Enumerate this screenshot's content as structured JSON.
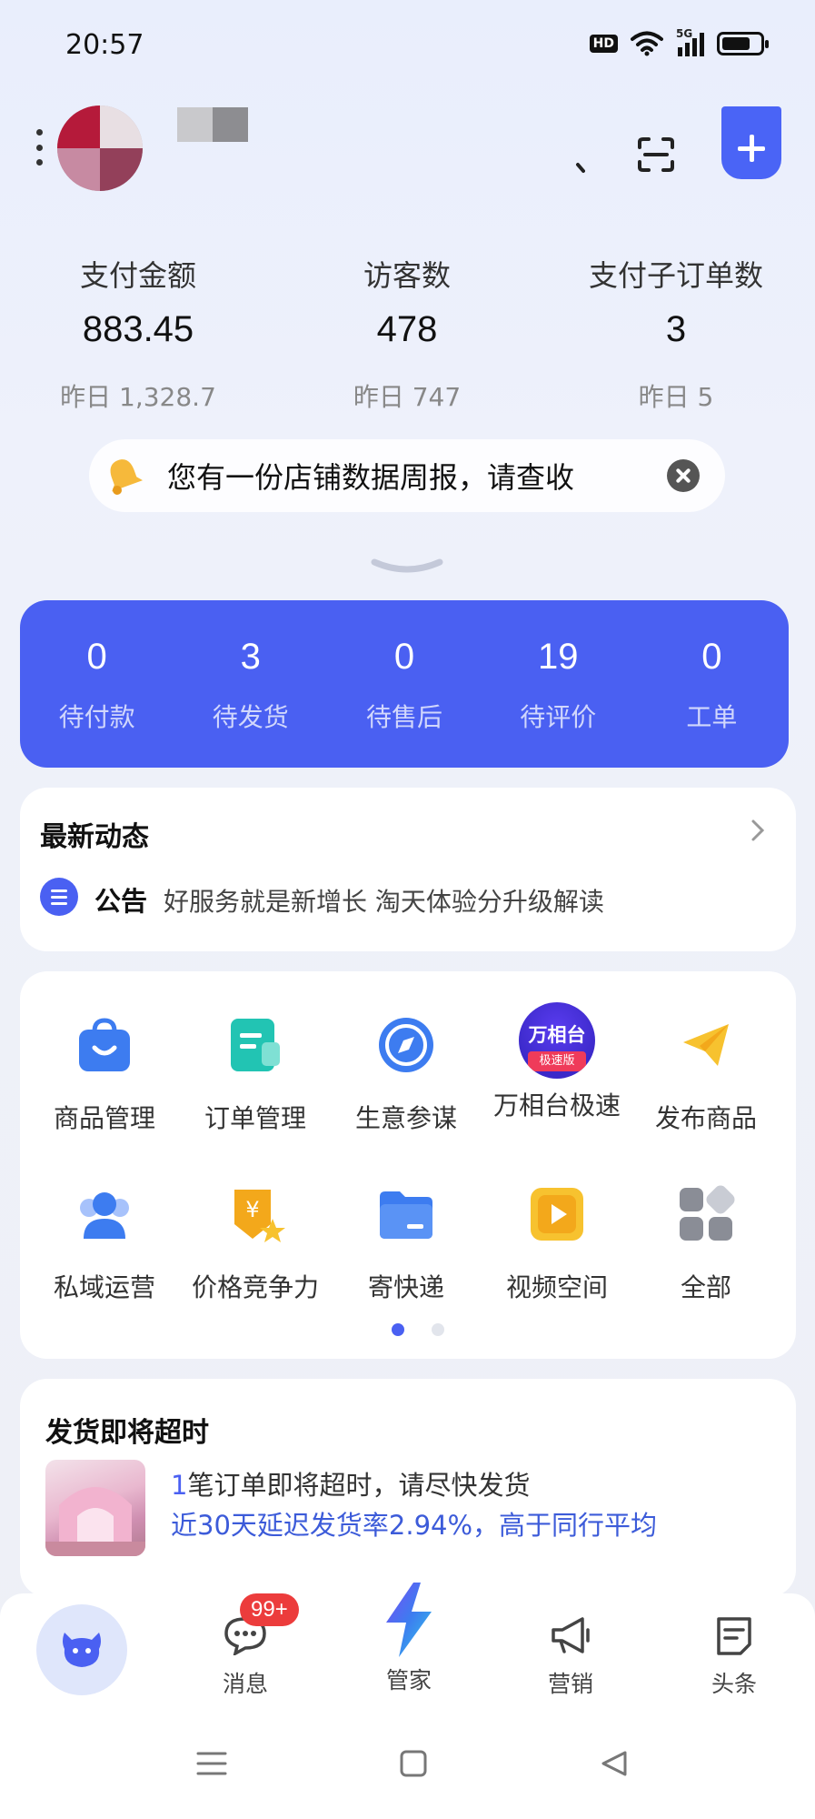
{
  "status_bar": {
    "time": "20:57",
    "hd": "HD",
    "network": "5G"
  },
  "stats": [
    {
      "label": "支付金额",
      "value": "883.45",
      "yesterday": "昨日 1,328.7"
    },
    {
      "label": "访客数",
      "value": "478",
      "yesterday": "昨日 747"
    },
    {
      "label": "支付子订单数",
      "value": "3",
      "yesterday": "昨日 5"
    }
  ],
  "notice": {
    "text": "您有一份店铺数据周报，请查收"
  },
  "orders": [
    {
      "count": "0",
      "label": "待付款"
    },
    {
      "count": "3",
      "label": "待发货"
    },
    {
      "count": "0",
      "label": "待售后"
    },
    {
      "count": "19",
      "label": "待评价"
    },
    {
      "count": "0",
      "label": "工单"
    }
  ],
  "news": {
    "title": "最新动态",
    "tag": "公告",
    "text": "好服务就是新增长 淘天体验分升级解读"
  },
  "tools": [
    {
      "label": "商品管理",
      "icon": "bag-icon"
    },
    {
      "label": "订单管理",
      "icon": "order-doc-icon"
    },
    {
      "label": "生意参谋",
      "icon": "compass-icon"
    },
    {
      "label": "万相台极速",
      "icon": "wanxiangtai-icon",
      "icon_text_top": "万相台",
      "icon_text_bottom": "极速版"
    },
    {
      "label": "发布商品",
      "icon": "paper-plane-icon"
    },
    {
      "label": "私域运营",
      "icon": "users-icon"
    },
    {
      "label": "价格竞争力",
      "icon": "price-tag-icon"
    },
    {
      "label": "寄快递",
      "icon": "folder-box-icon"
    },
    {
      "label": "视频空间",
      "icon": "video-play-icon"
    },
    {
      "label": "全部",
      "icon": "grid-all-icon"
    }
  ],
  "ship": {
    "title": "发货即将超时",
    "line1_count": "1",
    "line1_rest": "笔订单即将超时，请尽快发货",
    "line2": "近30天延迟发货率2.94%，高于同行平均"
  },
  "nav": {
    "messages": "消息",
    "badge": "99+",
    "assistant": "管家",
    "marketing": "营销",
    "headlines": "头条"
  },
  "colors": {
    "brand": "#4a60f2",
    "badge": "#ec3c3c"
  }
}
